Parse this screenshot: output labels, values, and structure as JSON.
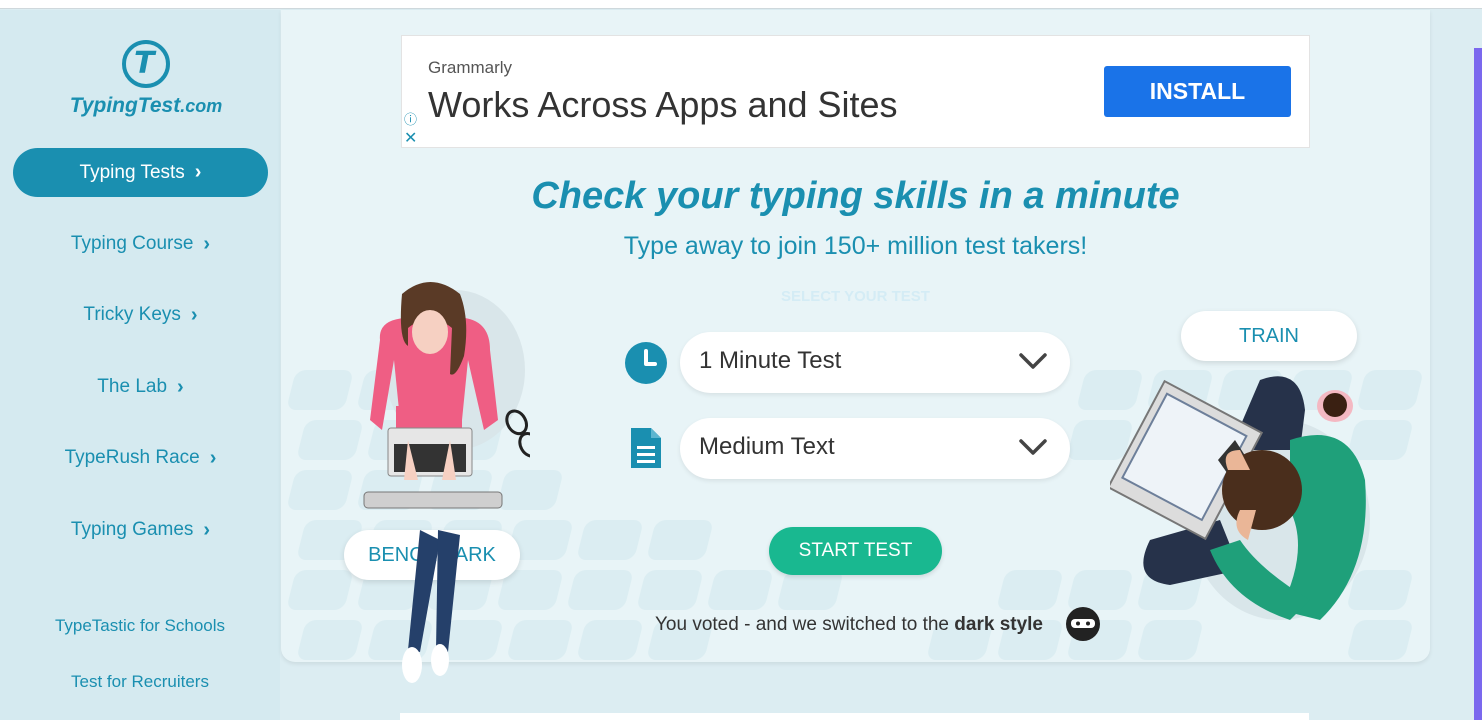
{
  "sidebar": {
    "logo_text": "TypingTest",
    "logo_suffix": ".com",
    "logo_glyph": "T",
    "active_item": {
      "label": "Typing Tests"
    },
    "items": [
      {
        "label": "Typing Course"
      },
      {
        "label": "Tricky Keys"
      },
      {
        "label": "The Lab"
      },
      {
        "label": "TypeRush Race"
      },
      {
        "label": "Typing Games"
      }
    ],
    "links": [
      {
        "label": "TypeTastic for Schools"
      },
      {
        "label": "Test for Recruiters"
      }
    ]
  },
  "ad": {
    "brand": "Grammarly",
    "title": "Works Across Apps and Sites",
    "button_label": "INSTALL",
    "info_icon": "info-icon",
    "close_icon": "close-icon"
  },
  "main": {
    "headline": "Check your typing skills in a minute",
    "subheadline": "Type away to join 150+ million test takers!",
    "select_label": "SELECT YOUR TEST",
    "duration_select": {
      "value": "1 Minute Test",
      "icon": "clock-icon"
    },
    "text_select": {
      "value": "Medium Text",
      "icon": "document-icon"
    },
    "start_button": "START TEST",
    "benchmark_button": "BENCHMARK",
    "train_button": "TRAIN",
    "dark_note_prefix": "You voted - and we switched to the ",
    "dark_note_bold": "dark style"
  },
  "colors": {
    "accent": "#1a8fb0",
    "start": "#19b890",
    "ad_button": "#1a73e8",
    "sidebar_bg": "#d5eaf0",
    "main_bg": "#e8f4f7"
  }
}
